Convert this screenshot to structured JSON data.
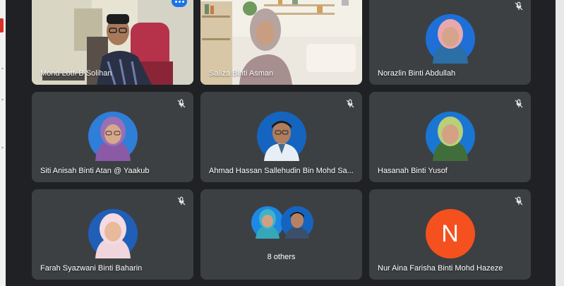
{
  "meeting": {
    "accent_color": "#8ab4f8",
    "tile_color": "#3c4043",
    "background_color": "#202124",
    "participants": [
      {
        "name": "Mohd Lotfi B Solihan",
        "type": "video",
        "active": true,
        "muted": false,
        "menu_icon": "more-options-icon"
      },
      {
        "name": "Saliza Binti Asman",
        "type": "video",
        "muted": false
      },
      {
        "name": "Norazlin Binti Abdullah",
        "type": "avatar",
        "muted": true
      },
      {
        "name": "Siti Anisah Binti Atan @ Yaakub",
        "type": "avatar",
        "muted": true
      },
      {
        "name": "Ahmad Hassan Sallehudin Bin Mohd Sa...",
        "type": "avatar",
        "muted": true
      },
      {
        "name": "Hasanah Binti Yusof",
        "type": "avatar",
        "muted": true
      },
      {
        "name": "Farah Syazwani Binti Baharin",
        "type": "avatar",
        "muted": true
      },
      {
        "name": "8 others",
        "type": "group",
        "muted": false
      },
      {
        "name": "Nur Aina Farisha Binti Mohd Hazeze",
        "type": "initial",
        "initial": "N",
        "initial_color": "#f4511e",
        "muted": true
      }
    ]
  }
}
